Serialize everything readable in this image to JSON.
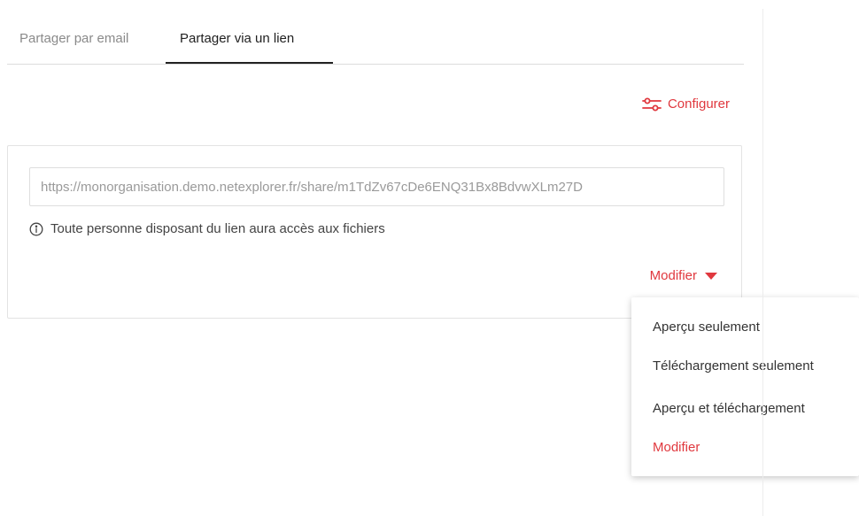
{
  "tabs": [
    {
      "label": "Partager par email",
      "active": false
    },
    {
      "label": "Partager via un lien",
      "active": true
    }
  ],
  "configure": {
    "label": "Configurer",
    "icon": "sliders-icon"
  },
  "link": {
    "value": "https://monorganisation.demo.netexplorer.fr/share/m1TdZv67cDe6ENQ31Bx8BdvwXLm27D",
    "info_text": "Toute personne disposant du lien aura accès aux fichiers",
    "info_icon": "info-circle-icon"
  },
  "permission_toggle": {
    "label": "Modifier",
    "icon": "caret-down-icon"
  },
  "dropdown": {
    "items": [
      {
        "label": "Aperçu seulement",
        "active": false
      },
      {
        "label": "Téléchargement seulement",
        "active": false
      },
      {
        "label": "Aperçu et téléchargement",
        "active": false
      },
      {
        "label": "Modifier",
        "active": true
      }
    ]
  },
  "colors": {
    "accent": "#e0383e",
    "text": "#333333",
    "muted": "#8a8a8a",
    "border": "#e3e3e3"
  }
}
